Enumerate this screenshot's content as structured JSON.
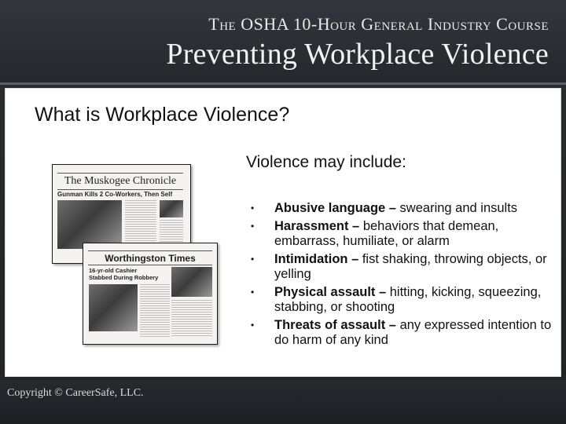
{
  "header": {
    "course_title": "The OSHA 10-Hour General Industry Course",
    "main_title": "Preventing Workplace Violence"
  },
  "slide": {
    "title": "What is Workplace Violence?",
    "subhead": "Violence may include:",
    "bullets": [
      {
        "term": "Abusive language –",
        "desc": " swearing and insults"
      },
      {
        "term": "Harassment –",
        "desc": " behaviors that demean, embarrass, humiliate, or alarm"
      },
      {
        "term": "Intimidation –",
        "desc": " fist shaking, throwing objects, or yelling"
      },
      {
        "term": "Physical assault –",
        "desc": " hitting, kicking, squeezing, stabbing, or shooting"
      },
      {
        "term": "Threats of assault –",
        "desc": " any expressed intention to do harm of any kind"
      }
    ]
  },
  "newspapers": {
    "paper1_masthead": "The Muskogee Chronicle",
    "paper1_headline": "Gunman Kills 2 Co-Workers, Then Self",
    "paper2_masthead": "Worthingston Times",
    "paper2_headline": "16-yr-old Cashier Stabbed During Robbery"
  },
  "footer": {
    "copyright": "Copyright © CareerSafe, LLC."
  }
}
